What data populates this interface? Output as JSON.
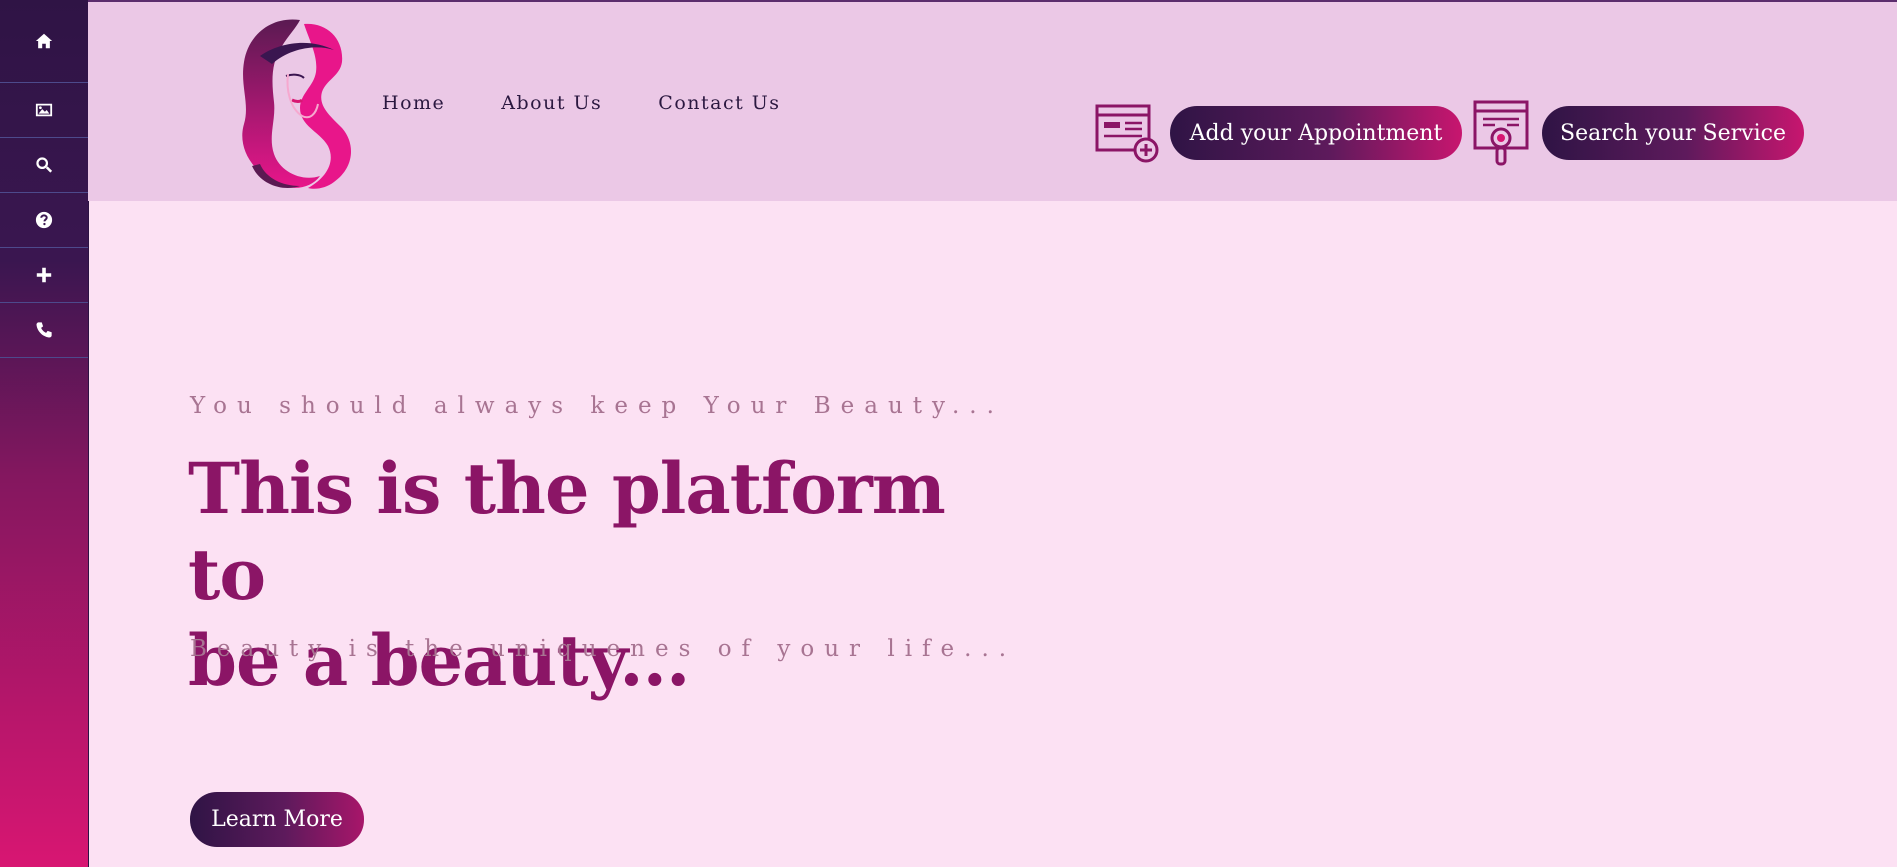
{
  "sidebar": {
    "items": [
      {
        "icon": "home-icon"
      },
      {
        "icon": "image-icon"
      },
      {
        "icon": "search-icon"
      },
      {
        "icon": "question-icon"
      },
      {
        "icon": "plus-icon"
      },
      {
        "icon": "phone-icon"
      }
    ]
  },
  "header": {
    "nav": [
      "Home",
      "About Us",
      "Contact Us"
    ],
    "add_appointment_label": "Add your Appointment",
    "search_service_label": "Search your Service"
  },
  "hero": {
    "tagline": "You should always keep Your Beauty...",
    "headline_line1": "This is the platform to",
    "headline_line2": "be a beauty...",
    "subline": "Beauty is the uniquenes of your life...",
    "cta_label": "Learn More"
  },
  "colors": {
    "accent_pink": "#d81672",
    "deep_purple": "#2f1445",
    "headline": "#8b1566",
    "page_bg": "#fce1f3",
    "header_bg": "#ebc8e6"
  }
}
